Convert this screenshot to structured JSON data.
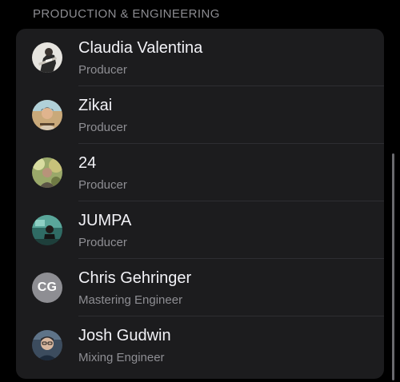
{
  "section": {
    "title": "PRODUCTION & ENGINEERING"
  },
  "people": [
    {
      "name": "Claudia Valentina",
      "role": "Producer",
      "avatar": "photo-avatar"
    },
    {
      "name": "Zikai",
      "role": "Producer",
      "avatar": "photo-avatar"
    },
    {
      "name": "24",
      "role": "Producer",
      "avatar": "photo-avatar"
    },
    {
      "name": "JUMPA",
      "role": "Producer",
      "avatar": "photo-avatar"
    },
    {
      "name": "Chris Gehringer",
      "role": "Mastering Engineer",
      "avatar": "initials-avatar",
      "initials": "CG"
    },
    {
      "name": "Josh Gudwin",
      "role": "Mixing Engineer",
      "avatar": "photo-avatar"
    }
  ],
  "colors": {
    "background": "#000000",
    "card": "#1c1c1e",
    "primary_text": "#f2f2f7",
    "secondary_text": "#8e8e93",
    "separator": "#2e2e32"
  }
}
